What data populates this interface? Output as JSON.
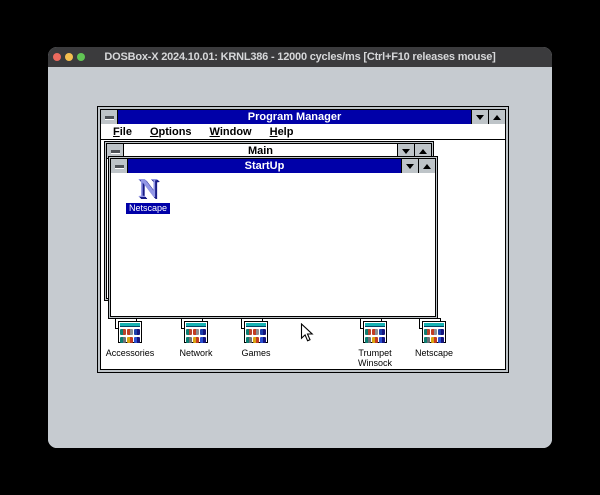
{
  "dosbox": {
    "title": "DOSBox-X 2024.10.01: KRNL386 - 12000 cycles/ms [Ctrl+F10 releases mouse]",
    "traffic_lights": [
      "close",
      "minimize",
      "zoom"
    ]
  },
  "program_manager": {
    "title": "Program Manager",
    "menu": [
      {
        "hotkey": "F",
        "rest": "ile"
      },
      {
        "hotkey": "O",
        "rest": "ptions"
      },
      {
        "hotkey": "W",
        "rest": "indow"
      },
      {
        "hotkey": "H",
        "rest": "elp"
      }
    ]
  },
  "windows": {
    "main": {
      "title": "Main",
      "active": false
    },
    "startup": {
      "title": "StartUp",
      "active": true
    }
  },
  "startup_items": [
    {
      "label": "Netscape",
      "selected": true,
      "icon": "netscape-n-icon"
    }
  ],
  "groups": [
    {
      "label": "Accessories"
    },
    {
      "label": "Network"
    },
    {
      "label": "Games"
    },
    {
      "label": "Trumpet Winsock"
    },
    {
      "label": "Netscape"
    }
  ],
  "pointer": {
    "type": "arrow"
  },
  "colors": {
    "active_titlebar": "#0000A8",
    "selection": "#0000A8",
    "desktop": "#C6CBD0",
    "window_frame": "#BEC4C8",
    "group_icon_titlebar": "#17B3B3",
    "dosbox_titlebar": "#3B3B3D",
    "traffic_red": "#EC6A5E",
    "traffic_yellow": "#F4BF4F",
    "traffic_green": "#61C554",
    "netscape_n_face": "#9297E6",
    "netscape_n_shadow": "#181C86"
  }
}
